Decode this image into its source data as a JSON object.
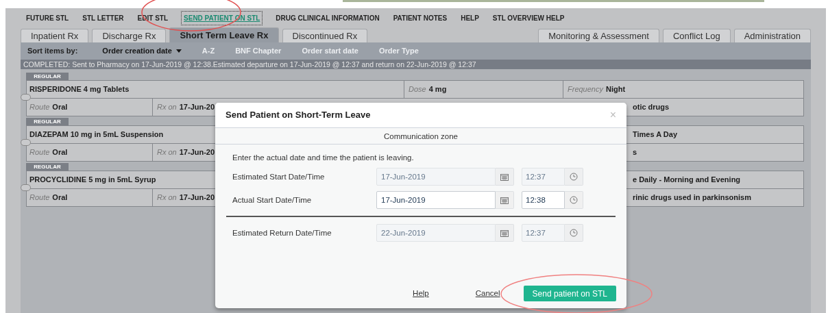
{
  "top_menu": [
    {
      "label": "FUTURE STL",
      "selected": false
    },
    {
      "label": "STL LETTER",
      "selected": false
    },
    {
      "label": "EDIT STL",
      "selected": false
    },
    {
      "label": "SEND PATIENT ON STL",
      "selected": true
    },
    {
      "label": "DRUG CLINICAL INFORMATION",
      "selected": false
    },
    {
      "label": "PATIENT NOTES",
      "selected": false
    },
    {
      "label": "HELP",
      "selected": false
    },
    {
      "label": "STL OVERVIEW HELP",
      "selected": false
    }
  ],
  "tabs_left": [
    {
      "label": "Inpatient Rx",
      "selected": false
    },
    {
      "label": "Discharge Rx",
      "selected": false
    },
    {
      "label": "Short Term Leave Rx",
      "selected": true
    },
    {
      "label": "Discontinued Rx",
      "selected": false
    }
  ],
  "tabs_right": [
    {
      "label": "Monitoring & Assessment",
      "selected": false
    },
    {
      "label": "Conflict Log",
      "selected": false
    },
    {
      "label": "Administration",
      "selected": false
    }
  ],
  "sort_bar": {
    "label": "Sort items by:",
    "options": [
      {
        "label": "Order creation date",
        "selected": true
      },
      {
        "label": "A-Z",
        "selected": false
      },
      {
        "label": "BNF Chapter",
        "selected": false
      },
      {
        "label": "Order start date",
        "selected": false
      },
      {
        "label": "Order Type",
        "selected": false
      }
    ]
  },
  "status_message": "COMPLETED: Sent to Pharmacy on 17-Jun-2019 @ 12:38.Estimated departure on 17-Jun-2019 @ 12:37 and return on 22-Jun-2019 @ 12:37",
  "orders": [
    {
      "tag": "REGULAR",
      "name": "RISPERIDONE 4 mg Tablets",
      "dose_label": "Dose",
      "dose": "4 mg",
      "frequency_label": "Frequency",
      "frequency": "Night",
      "route_label": "Route",
      "route": "Oral",
      "rx_label": "Rx on",
      "rx_date": "17-Jun-20",
      "line2_right": "otic drugs"
    },
    {
      "tag": "REGULAR",
      "name": "DIAZEPAM 10 mg in 5mL Suspension",
      "line1_right": "Times A Day",
      "route_label": "Route",
      "route": "Oral",
      "rx_label": "Rx on",
      "rx_date": "17-Jun-20",
      "line2_right": "s"
    },
    {
      "tag": "REGULAR",
      "name": "PROCYCLIDINE 5 mg in 5mL Syrup",
      "line1_right": "e Daily - Morning and Evening",
      "route_label": "Route",
      "route": "Oral",
      "rx_label": "Rx on",
      "rx_date": "17-Jun-20",
      "line2_right": "rinic drugs used in parkinsonism"
    }
  ],
  "dialog": {
    "title": "Send Patient on Short-Term Leave",
    "close": "×",
    "zone": "Communication zone",
    "instruction": "Enter the actual date and time the patient is leaving.",
    "field_groups": [
      {
        "rows": [
          {
            "label": "Estimated Start Date/Time",
            "date": "17-Jun-2019",
            "time": "12:37",
            "disabled": true
          },
          {
            "label": "Actual Start Date/Time",
            "date": "17-Jun-2019",
            "time": "12:38",
            "disabled": false
          }
        ]
      },
      {
        "rows": [
          {
            "label": "Estimated Return Date/Time",
            "date": "22-Jun-2019",
            "time": "12:37",
            "disabled": true
          }
        ]
      }
    ],
    "help_link": "Help",
    "cancel_link": "Cancel",
    "primary_button": "Send patient on STL"
  }
}
